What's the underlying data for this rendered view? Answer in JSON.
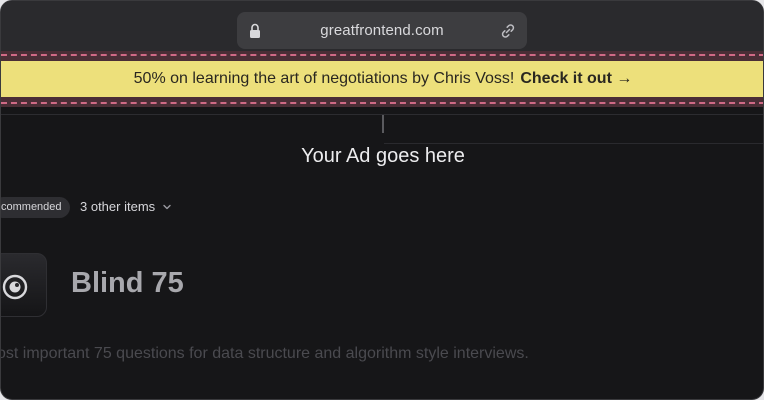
{
  "browser": {
    "url": "greatfrontend.com",
    "lock_icon": "lock-icon",
    "link_icon": "link-icon"
  },
  "promo_banner": {
    "text": "50% on learning the art of negotiations by Chris Voss!",
    "cta": "Check it out →",
    "colors": {
      "background": "#ede07b",
      "border": "#d06a86"
    }
  },
  "ad": {
    "text": "Your Ad goes here"
  },
  "filters": {
    "badge": "commended",
    "other_items": "3 other items"
  },
  "list": {
    "icon": "eye-icon",
    "title": "Blind 75",
    "description": "ost important 75 questions for data structure and algorithm style interviews."
  }
}
